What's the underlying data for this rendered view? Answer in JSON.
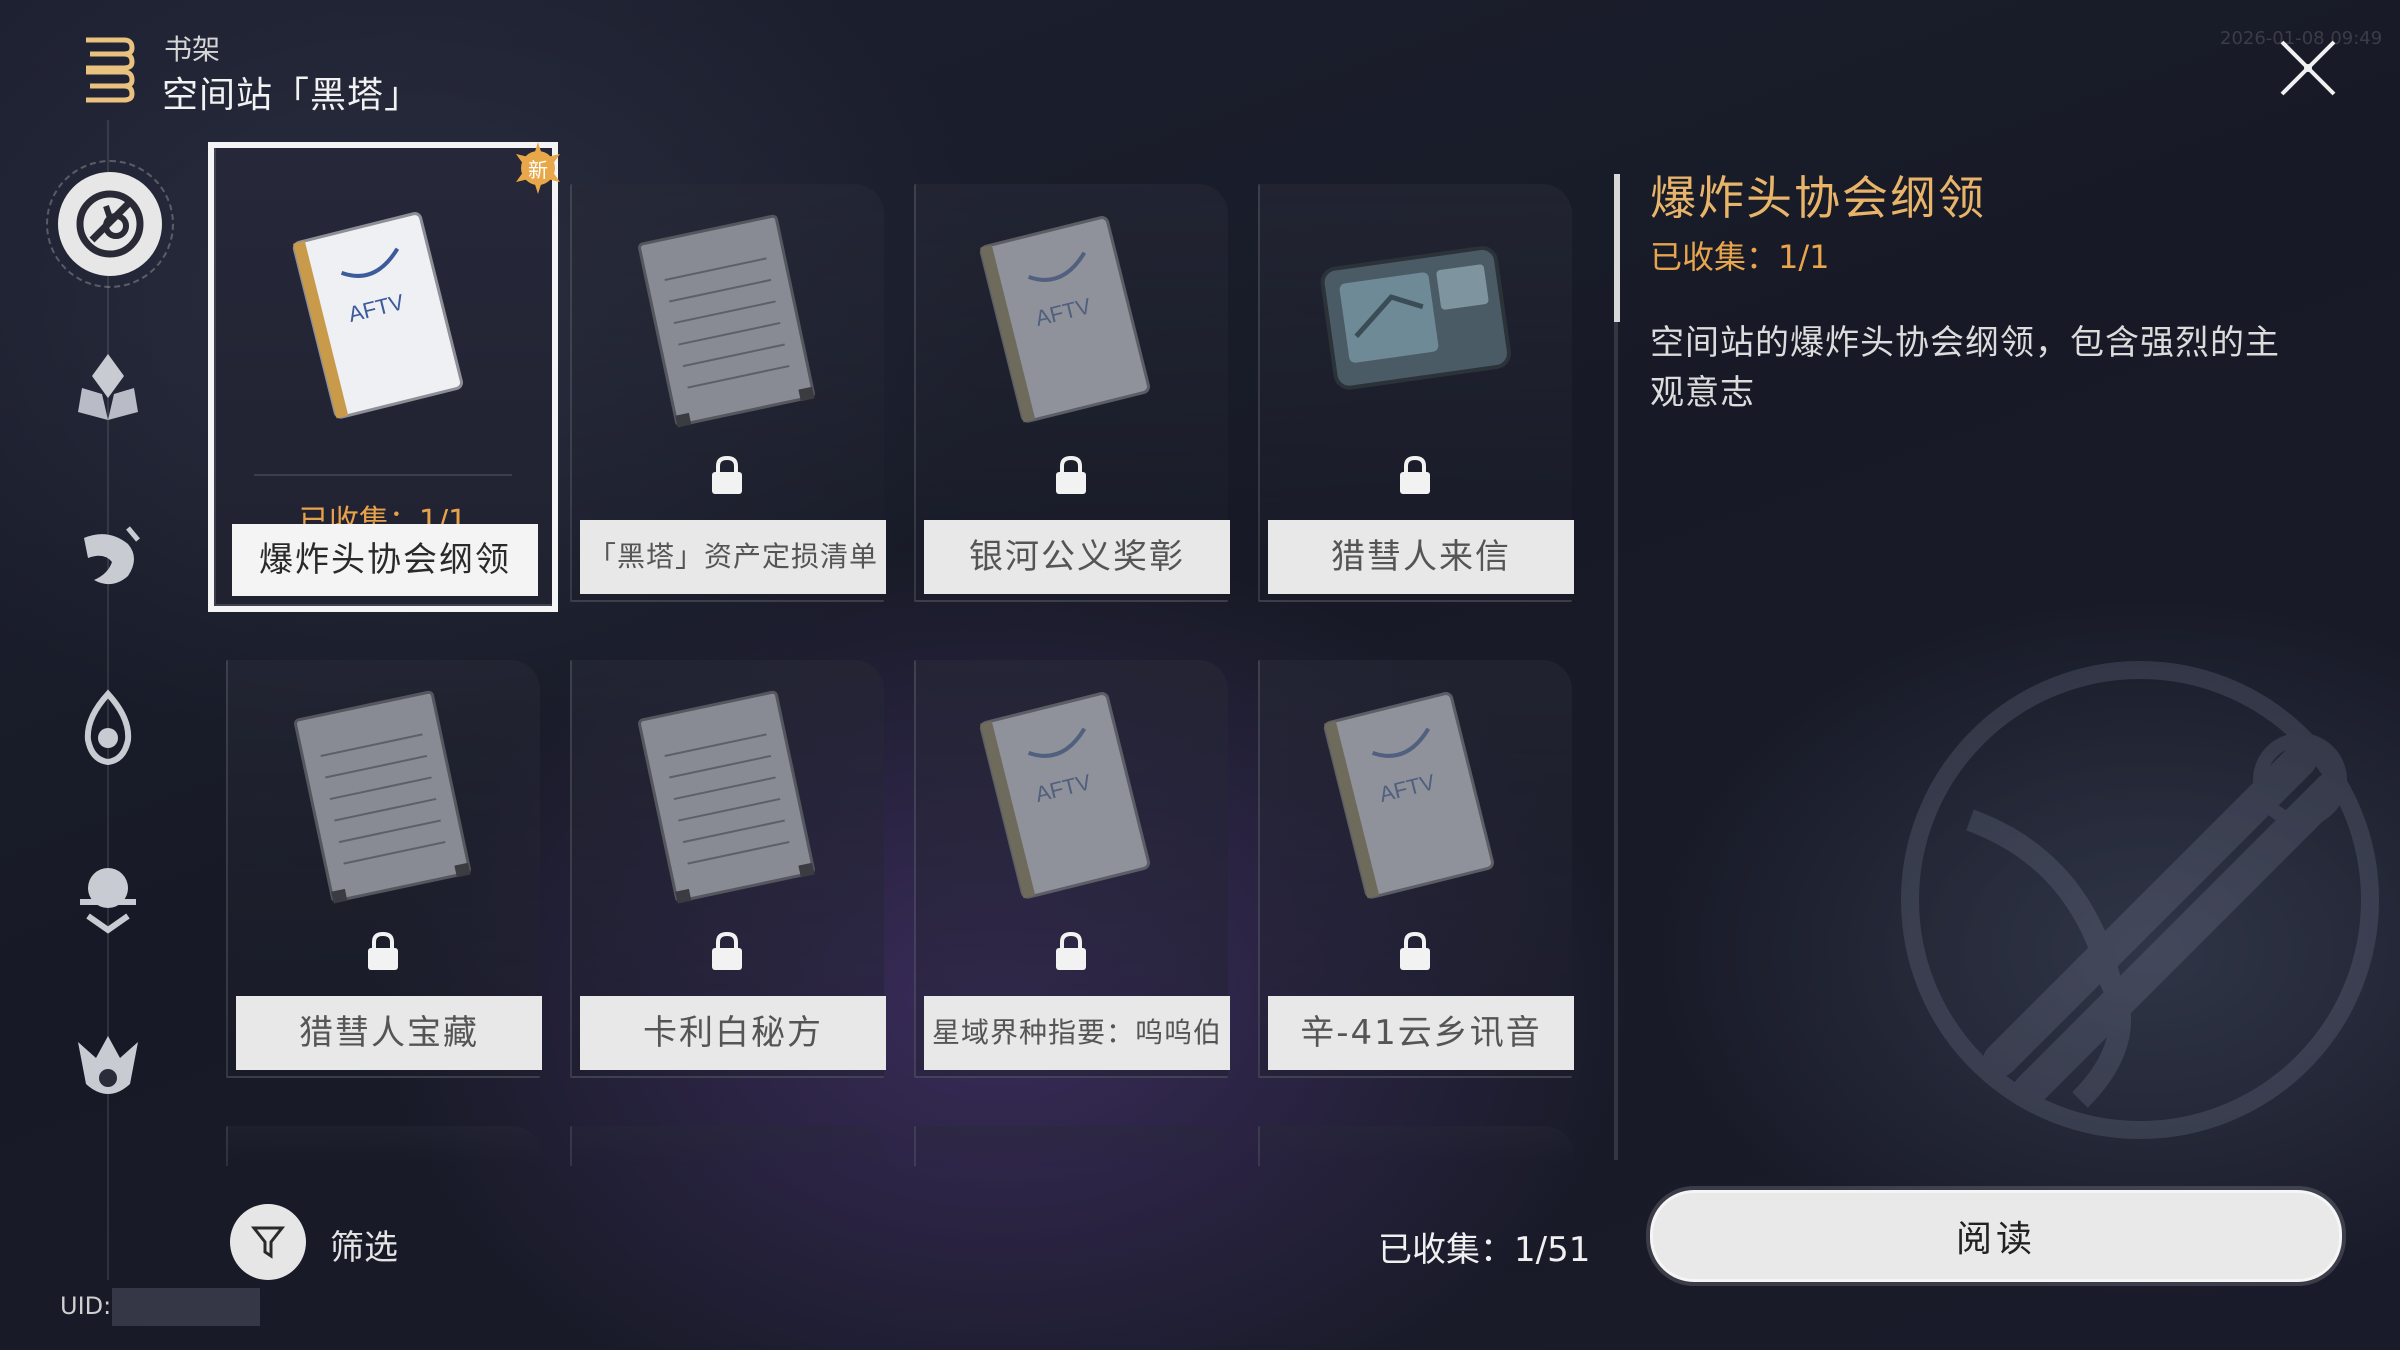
{
  "header": {
    "subtitle": "书架",
    "title": "空间站「黑塔」",
    "timestamp": "2026-01-08 09:49"
  },
  "nav": {
    "items": [
      {
        "name": "space-station",
        "icon": "herta-station-icon",
        "active": true
      },
      {
        "name": "jarilo",
        "icon": "lotus-icon",
        "active": false
      },
      {
        "name": "luofu",
        "icon": "dragon-icon",
        "active": false
      },
      {
        "name": "penacony",
        "icon": "flame-icon",
        "active": false
      },
      {
        "name": "other",
        "icon": "star-rail-icon",
        "active": false
      },
      {
        "name": "amphoreus",
        "icon": "crown-icon",
        "active": false
      }
    ],
    "uid_label": "UID:"
  },
  "books": [
    {
      "name": "爆炸头协会纲领",
      "book": "white",
      "locked": false,
      "collected": "已收集：1/1",
      "new": true,
      "badge": "新"
    },
    {
      "name": "「黑塔」资产定损清单",
      "book": "notebook",
      "locked": true
    },
    {
      "name": "银河公义奖彰",
      "book": "grey",
      "locked": true
    },
    {
      "name": "猎彗人来信",
      "book": "tablet",
      "locked": true
    },
    {
      "name": "猎彗人宝藏",
      "book": "notebook",
      "locked": true
    },
    {
      "name": "卡利白秘方",
      "book": "notebook",
      "locked": true
    },
    {
      "name": "星域界种指要：呜呜伯",
      "book": "grey",
      "locked": true
    },
    {
      "name": "辛-41云乡讯音",
      "book": "grey",
      "locked": true
    }
  ],
  "bottom": {
    "filter_label": "筛选",
    "total_collected": "已收集：1/51"
  },
  "detail": {
    "title": "爆炸头协会纲领",
    "collected": "已收集：1/1",
    "description": "空间站的爆炸头协会纲领，包含强烈的主观意志",
    "read_label": "阅读"
  },
  "colors": {
    "accent_gold": "#e7b469",
    "collected_orange": "#e7a54c",
    "selection_white": "#f4f4f4"
  }
}
